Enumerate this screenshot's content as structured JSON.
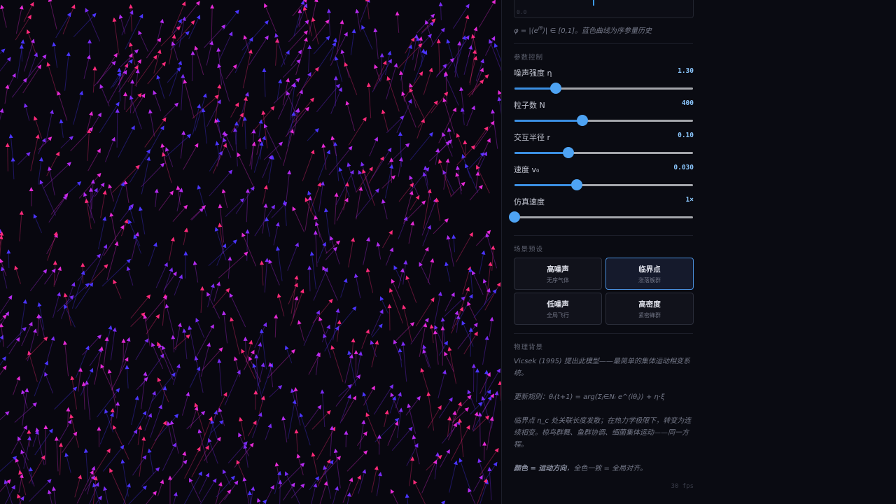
{
  "chart": {
    "axis_label": "0.0",
    "caption_prefix": "φ = |⟨e",
    "caption_sup": "iθ",
    "caption_suffix": "⟩| ∈ [0,1]。蓝色曲线为序参量历史"
  },
  "params": {
    "section_title": "参数控制",
    "items": [
      {
        "label": "噪声强度 η",
        "value": "1.30",
        "fraction": 0.23
      },
      {
        "label": "粒子数 N",
        "value": "400",
        "fraction": 0.38
      },
      {
        "label": "交互半径 r",
        "value": "0.10",
        "fraction": 0.3
      },
      {
        "label": "速度 v₀",
        "value": "0.030",
        "fraction": 0.35
      },
      {
        "label": "仿真速度",
        "value": "1×",
        "fraction": 0.0
      }
    ]
  },
  "presets": {
    "section_title": "场景预设",
    "items": [
      {
        "title": "高噪声",
        "sub": "无序气体",
        "active": false
      },
      {
        "title": "临界点",
        "sub": "涨落簇群",
        "active": true
      },
      {
        "title": "低噪声",
        "sub": "全局飞行",
        "active": false
      },
      {
        "title": "高密度",
        "sub": "紧密蜂群",
        "active": false
      }
    ]
  },
  "background": {
    "section_title": "物理背景",
    "p1": "Vicsek (1995) 提出此模型——最简单的集体运动相变系统。",
    "p2": "更新规则：θᵢ(t+1) = arg(Σⱼ∈Nᵢ e^(iθⱼ)) + η·ξ",
    "p3": "临界点 η_c 处关联长度发散；在热力学极限下，转变为连续相变。椋鸟群舞、鱼群协调、细菌集体运动——同一方程。",
    "p4_bold": "颜色 = 运动方向",
    "p4_rest": "，全色一致 = 全局对齐。"
  },
  "fps": "30 fps",
  "colors": {
    "accent": "#4ea3f3",
    "particle_palette": [
      "#ff2a7a",
      "#e62ad6",
      "#b42bf0",
      "#7a2cf5",
      "#4b35ff"
    ]
  }
}
